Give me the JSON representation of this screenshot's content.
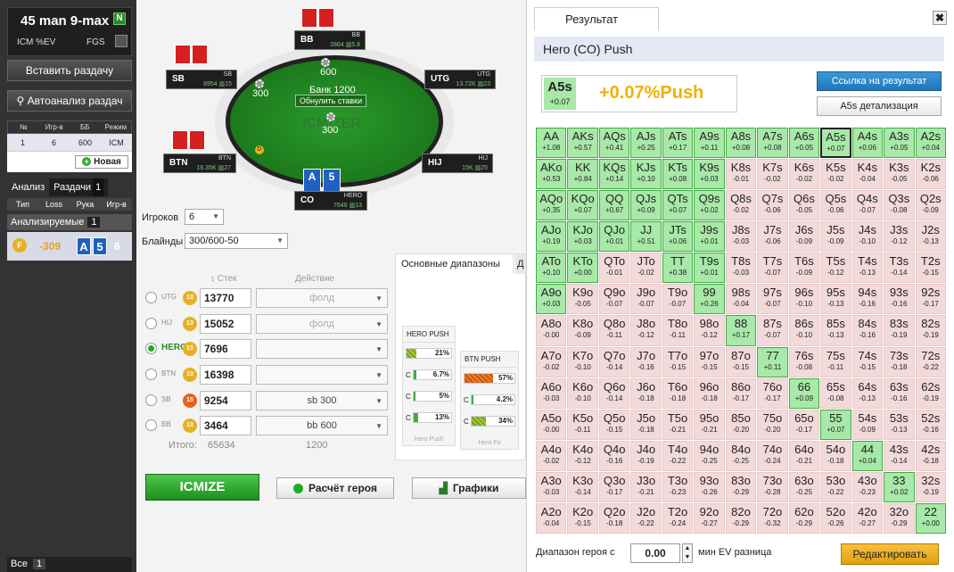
{
  "sidebar": {
    "title": "45 man 9-max",
    "n_badge": "N",
    "icm_label": "ICM %EV",
    "fgs_label": "FGS",
    "insert_btn": "Вставить раздачу",
    "auto_btn": "Автоанализ раздач",
    "table": {
      "headers": [
        "№",
        "Игр-в",
        "ББ",
        "Режим"
      ],
      "row": [
        "1",
        "6",
        "600",
        "ICM %EV"
      ],
      "new_btn": "Новая"
    },
    "tabs": {
      "analysis": "Анализ",
      "hands": "Раздачи",
      "hands_count": "1"
    },
    "cols": [
      "Тип",
      "Loss",
      "Рука",
      "Игр-в"
    ],
    "analyzed_label": "Анализируемые",
    "analyzed_count": "1",
    "hand": {
      "coin": "F",
      "loss": "-309",
      "card1": "A",
      "card2": "5",
      "players": "6"
    },
    "all_label": "Все",
    "all_count": "1"
  },
  "table": {
    "pot_label": "Банк 1200",
    "reset_label": "Обнулить ставки",
    "logo": "ICMIZER",
    "bet_top": "600",
    "bet_left": "300",
    "bet_mid": "300",
    "dealer": "D",
    "seats": [
      {
        "id": "bb",
        "name": "BB",
        "stack": "2864",
        "bb": "5.8"
      },
      {
        "id": "utg",
        "name": "UTG",
        "stack": "13.72K",
        "bb": "23"
      },
      {
        "id": "sb",
        "name": "SB",
        "stack": "8954",
        "bb": "15"
      },
      {
        "id": "btn",
        "name": "BTN",
        "stack": "16.35K",
        "bb": "27"
      },
      {
        "id": "hj",
        "name": "HIJ",
        "stack": "15K",
        "bb": "25"
      },
      {
        "id": "co",
        "name": "CO",
        "stack": "7646",
        "bb": "13"
      }
    ],
    "hero_label": "HERO",
    "hero_cards": [
      "A",
      "5"
    ]
  },
  "settings": {
    "players_label": "Игроков",
    "players_value": "6",
    "blinds_label": "Блайнды",
    "blinds_value": "300/600-50",
    "stack_col": "Стек",
    "action_col": "Действие",
    "players": [
      {
        "pos": "UTG",
        "bb": "13",
        "stack": "13770",
        "action": "фолд"
      },
      {
        "pos": "HIJ",
        "bb": "13",
        "stack": "15052",
        "action": "фолд"
      },
      {
        "pos": "HERO",
        "bb": "13",
        "stack": "7696",
        "action": ""
      },
      {
        "pos": "BTN",
        "bb": "13",
        "stack": "16398",
        "action": ""
      },
      {
        "pos": "SB",
        "bb": "15",
        "stack": "9254",
        "action": "sb 300"
      },
      {
        "pos": "BB",
        "bb": "13",
        "stack": "3464",
        "action": "bb 600"
      }
    ],
    "total_label": "Итого:",
    "total_stack": "65634",
    "total_action": "1200"
  },
  "ranges": {
    "tab_main": "Основные диапазоны",
    "tab_other": "Д",
    "hero": {
      "title": "HERO PUSH",
      "main": "21%",
      "c": [
        "6.7%",
        "5%",
        "13%"
      ],
      "footer": "Hero Push",
      "main_pct": 21,
      "c_pct": [
        6.7,
        5,
        13
      ]
    },
    "btn": {
      "title": "BTN PUSH",
      "main": "57%",
      "c": [
        "4.2%",
        "34%"
      ],
      "footer": "Hero Fo",
      "main_pct": 57,
      "c_pct": [
        4.2,
        34
      ]
    },
    "c_label": "C"
  },
  "buttons": {
    "icmize": "ICMIZE",
    "calc": "Расчёт героя",
    "charts": "Графики"
  },
  "result": {
    "tab": "Результат",
    "close": "✖",
    "header": "Hero (CO) Push",
    "hand": "A5s",
    "hand_ev": "+0.07",
    "result_text": "+0.07%Push",
    "link_btn": "Ссылка на результат",
    "detail_btn": "A5s детализация",
    "footer_label": "Диапазон героя с",
    "ev_value": "0.00",
    "footer_label2": "мин EV разница",
    "edit_btn": "Редактировать",
    "grid": [
      [
        "AA",
        "+1.08",
        "AKs",
        "+0.57",
        "AQs",
        "+0.41",
        "AJs",
        "+0.25",
        "ATs",
        "+0.17",
        "A9s",
        "+0.11",
        "A8s",
        "+0.08",
        "A7s",
        "+0.08",
        "A6s",
        "+0.05",
        "A5s",
        "+0.07",
        "A4s",
        "+0.06",
        "A3s",
        "+0.05",
        "A2s",
        "+0.04"
      ],
      [
        "AKo",
        "+0.53",
        "KK",
        "+0.84",
        "KQs",
        "+0.14",
        "KJs",
        "+0.10",
        "KTs",
        "+0.08",
        "K9s",
        "+0.03",
        "K8s",
        "-0.01",
        "K7s",
        "-0.02",
        "K6s",
        "-0.02",
        "K5s",
        "-0.02",
        "K4s",
        "-0.04",
        "K3s",
        "-0.05",
        "K2s",
        "-0.06"
      ],
      [
        "AQo",
        "+0.35",
        "KQo",
        "+0.07",
        "QQ",
        "+0.67",
        "QJs",
        "+0.09",
        "QTs",
        "+0.07",
        "Q9s",
        "+0.02",
        "Q8s",
        "-0.02",
        "Q7s",
        "-0.06",
        "Q6s",
        "-0.05",
        "Q5s",
        "-0.06",
        "Q4s",
        "-0.07",
        "Q3s",
        "-0.08",
        "Q2s",
        "-0.09"
      ],
      [
        "AJo",
        "+0.19",
        "KJo",
        "+0.03",
        "QJo",
        "+0.01",
        "JJ",
        "+0.51",
        "JTs",
        "+0.06",
        "J9s",
        "+0.01",
        "J8s",
        "-0.03",
        "J7s",
        "-0.06",
        "J6s",
        "-0.09",
        "J5s",
        "-0.09",
        "J4s",
        "-0.10",
        "J3s",
        "-0.12",
        "J2s",
        "-0.13"
      ],
      [
        "ATo",
        "+0.10",
        "KTo",
        "+0.00",
        "QTo",
        "-0.01",
        "JTo",
        "-0.02",
        "TT",
        "+0.38",
        "T9s",
        "+0.01",
        "T8s",
        "-0.03",
        "T7s",
        "-0.07",
        "T6s",
        "-0.09",
        "T5s",
        "-0.12",
        "T4s",
        "-0.13",
        "T3s",
        "-0.14",
        "T2s",
        "-0.15"
      ],
      [
        "A9o",
        "+0.03",
        "K9o",
        "-0.05",
        "Q9o",
        "-0.07",
        "J9o",
        "-0.07",
        "T9o",
        "-0.07",
        "99",
        "+0.26",
        "98s",
        "-0.04",
        "97s",
        "-0.07",
        "96s",
        "-0.10",
        "95s",
        "-0.13",
        "94s",
        "-0.16",
        "93s",
        "-0.16",
        "92s",
        "-0.17"
      ],
      [
        "A8o",
        "-0.00",
        "K8o",
        "-0.09",
        "Q8o",
        "-0.11",
        "J8o",
        "-0.12",
        "T8o",
        "-0.11",
        "98o",
        "-0.12",
        "88",
        "+0.17",
        "87s",
        "-0.07",
        "86s",
        "-0.10",
        "85s",
        "-0.13",
        "84s",
        "-0.16",
        "83s",
        "-0.19",
        "82s",
        "-0.19"
      ],
      [
        "A7o",
        "-0.02",
        "K7o",
        "-0.10",
        "Q7o",
        "-0.14",
        "J7o",
        "-0.16",
        "T7o",
        "-0.15",
        "97o",
        "-0.15",
        "87o",
        "-0.15",
        "77",
        "+0.11",
        "76s",
        "-0.08",
        "75s",
        "-0.11",
        "74s",
        "-0.15",
        "73s",
        "-0.18",
        "72s",
        "-0.22"
      ],
      [
        "A6o",
        "-0.03",
        "K6o",
        "-0.10",
        "Q6o",
        "-0.14",
        "J6o",
        "-0.18",
        "T6o",
        "-0.18",
        "96o",
        "-0.18",
        "86o",
        "-0.17",
        "76o",
        "-0.17",
        "66",
        "+0.09",
        "65s",
        "-0.08",
        "64s",
        "-0.13",
        "63s",
        "-0.16",
        "62s",
        "-0.19"
      ],
      [
        "A5o",
        "-0.00",
        "K5o",
        "-0.11",
        "Q5o",
        "-0.15",
        "J5o",
        "-0.18",
        "T5o",
        "-0.21",
        "95o",
        "-0.21",
        "85o",
        "-0.20",
        "75o",
        "-0.20",
        "65o",
        "-0.17",
        "55",
        "+0.07",
        "54s",
        "-0.09",
        "53s",
        "-0.13",
        "52s",
        "-0.16"
      ],
      [
        "A4o",
        "-0.02",
        "K4o",
        "-0.12",
        "Q4o",
        "-0.16",
        "J4o",
        "-0.19",
        "T4o",
        "-0.22",
        "94o",
        "-0.25",
        "84o",
        "-0.25",
        "74o",
        "-0.24",
        "64o",
        "-0.21",
        "54o",
        "-0.18",
        "44",
        "+0.04",
        "43s",
        "-0.14",
        "42s",
        "-0.18"
      ],
      [
        "A3o",
        "-0.03",
        "K3o",
        "-0.14",
        "Q3o",
        "-0.17",
        "J3o",
        "-0.21",
        "T3o",
        "-0.23",
        "93o",
        "-0.26",
        "83o",
        "-0.29",
        "73o",
        "-0.28",
        "63o",
        "-0.25",
        "53o",
        "-0.22",
        "43o",
        "-0.23",
        "33",
        "+0.02",
        "32s",
        "-0.19"
      ],
      [
        "A2o",
        "-0.04",
        "K2o",
        "-0.15",
        "Q2o",
        "-0.18",
        "J2o",
        "-0.22",
        "T2o",
        "-0.24",
        "92o",
        "-0.27",
        "82o",
        "-0.29",
        "72o",
        "-0.32",
        "62o",
        "-0.29",
        "52o",
        "-0.26",
        "42o",
        "-0.27",
        "32o",
        "-0.29",
        "22",
        "+0.00"
      ]
    ]
  }
}
